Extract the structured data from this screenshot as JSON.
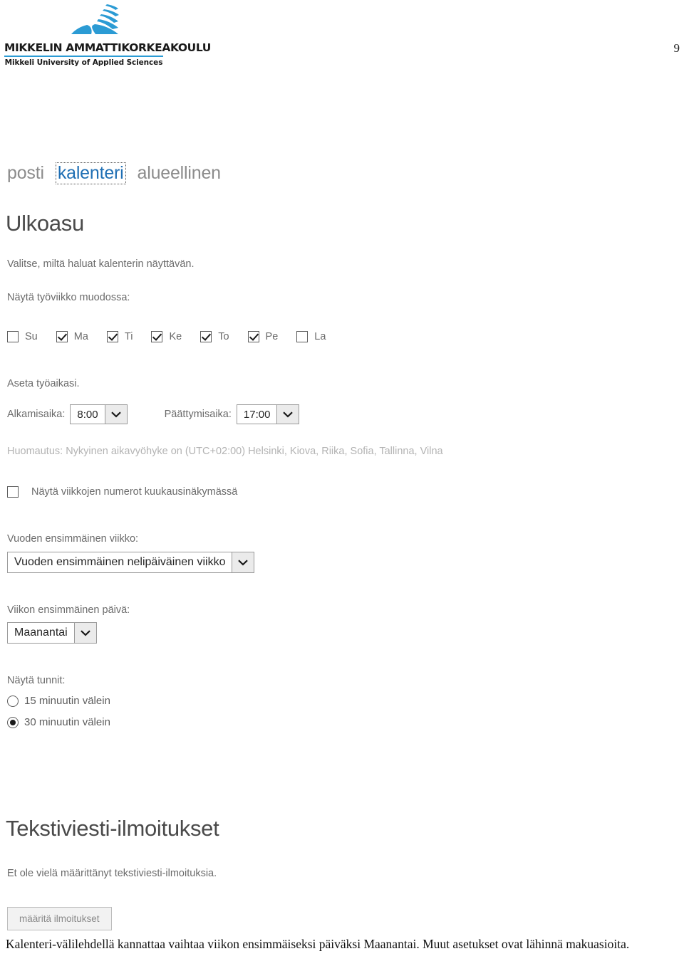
{
  "document": {
    "page_number": "9",
    "logo": {
      "wordmark": "MIKKELIN AMMATTIKORKEAKOULU",
      "subtitle": "Mikkeli University of Applied Sciences",
      "mark_icon": "book-waves-logo-icon",
      "brand_color": "#2b9bd4"
    },
    "caption": "Kalenteri-välilehdellä kannattaa vaihtaa viikon ensimmäiseksi päiväksi Maanantai. Muut asetukset ovat lähinnä makuasioita."
  },
  "tabs": [
    {
      "label": "posti",
      "active": false
    },
    {
      "label": "kalenteri",
      "active": true
    },
    {
      "label": "alueellinen",
      "active": false
    }
  ],
  "appearance": {
    "title": "Ulkoasu",
    "description": "Valitse, miltä haluat kalenterin näyttävän.",
    "workweek_label": "Näytä työviikko muodossa:",
    "weekdays": [
      {
        "label": "Su",
        "checked": false
      },
      {
        "label": "Ma",
        "checked": true
      },
      {
        "label": "Ti",
        "checked": true
      },
      {
        "label": "Ke",
        "checked": true
      },
      {
        "label": "To",
        "checked": true
      },
      {
        "label": "Pe",
        "checked": true
      },
      {
        "label": "La",
        "checked": false
      }
    ],
    "worktime_label": "Aseta työaikasi.",
    "start_time": {
      "label": "Alkamisaika:",
      "value": "8:00"
    },
    "end_time": {
      "label": "Päättymisaika:",
      "value": "17:00"
    },
    "timezone_note": "Huomautus: Nykyinen aikavyöhyke on (UTC+02:00) Helsinki, Kiova, Riika, Sofia, Tallinna, Vilna",
    "week_numbers": {
      "label": "Näytä viikkojen numerot kuukausinäkymässä",
      "checked": false
    },
    "first_week": {
      "label": "Vuoden ensimmäinen viikko:",
      "value": "Vuoden ensimmäinen nelipäiväinen viikko"
    },
    "first_day": {
      "label": "Viikon ensimmäinen päivä:",
      "value": "Maanantai"
    },
    "show_hours": {
      "label": "Näytä tunnit:",
      "options": [
        {
          "label": "15 minuutin välein",
          "selected": false
        },
        {
          "label": "30 minuutin välein",
          "selected": true
        }
      ]
    }
  },
  "sms": {
    "title": "Tekstiviesti-ilmoitukset",
    "description": "Et ole vielä määrittänyt tekstiviesti-ilmoituksia.",
    "configure_button": "määritä ilmoitukset"
  },
  "icons": {
    "chevron_down": "chevron-down-icon",
    "checkmark": "checkmark-icon",
    "radio_dot": "radio-dot-icon"
  }
}
